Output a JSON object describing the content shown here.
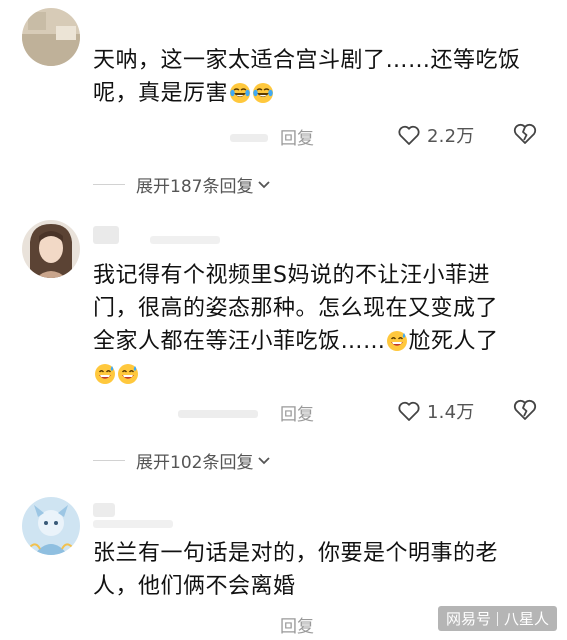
{
  "comments": [
    {
      "text_lines": [
        "天呐，这一家太适合宫斗剧了……还等吃饭",
        "呢，真是厉害"
      ],
      "emojis": [
        "laughing-crying",
        "laughing-crying"
      ],
      "reply_label": "回复",
      "likes": "2.2万",
      "expand_label": "展开187条回复"
    },
    {
      "text_lines": [
        "我记得有个视频里S妈说的不让汪小菲进",
        "门，很高的姿态那种。怎么现在又变成了",
        "全家人都在等汪小菲吃饭……",
        "尬死人了"
      ],
      "emojis": [
        "grinning-sweat",
        "grinning-sweat",
        "grinning-sweat"
      ],
      "reply_label": "回复",
      "likes": "1.4万",
      "expand_label": "展开102条回复"
    },
    {
      "text_lines": [
        "张兰有一句话是对的，你要是个明事的老",
        "人，他们俩不会离婚"
      ],
      "reply_label": "回复"
    }
  ],
  "watermark": {
    "brand": "网易号",
    "account": "八星人"
  },
  "colors": {
    "text": "#111111",
    "meta": "#9a9a9a",
    "like_count": "#555555",
    "icon_stroke": "#444444"
  }
}
